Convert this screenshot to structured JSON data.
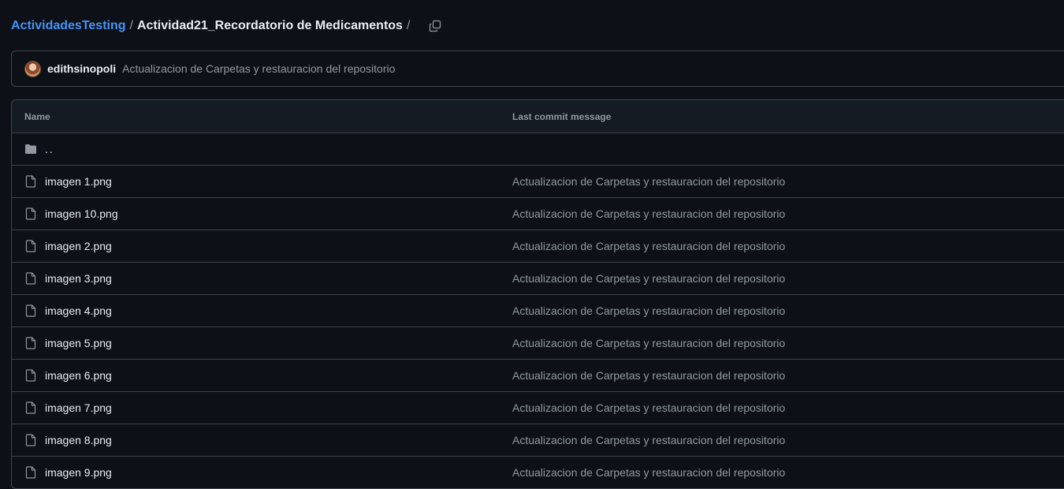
{
  "breadcrumb": {
    "repo": "ActividadesTesting",
    "separator": "/",
    "folder": "Actividad21_Recordatorio de Medicamentos",
    "trailing_separator": "/",
    "copy_icon": "copy-icon"
  },
  "commit": {
    "author": "edithsinopoli",
    "message": "Actualizacion de Carpetas y restauracion del repositorio"
  },
  "table": {
    "headers": {
      "name": "Name",
      "message": "Last commit message"
    },
    "parent_link": "..",
    "files": [
      {
        "name": "imagen 1.png",
        "message": "Actualizacion de Carpetas y restauracion del repositorio"
      },
      {
        "name": "imagen 10.png",
        "message": "Actualizacion de Carpetas y restauracion del repositorio"
      },
      {
        "name": "imagen 2.png",
        "message": "Actualizacion de Carpetas y restauracion del repositorio"
      },
      {
        "name": "imagen 3.png",
        "message": "Actualizacion de Carpetas y restauracion del repositorio"
      },
      {
        "name": "imagen 4.png",
        "message": "Actualizacion de Carpetas y restauracion del repositorio"
      },
      {
        "name": "imagen 5.png",
        "message": "Actualizacion de Carpetas y restauracion del repositorio"
      },
      {
        "name": "imagen 6.png",
        "message": "Actualizacion de Carpetas y restauracion del repositorio"
      },
      {
        "name": "imagen 7.png",
        "message": "Actualizacion de Carpetas y restauracion del repositorio"
      },
      {
        "name": "imagen 8.png",
        "message": "Actualizacion de Carpetas y restauracion del repositorio"
      },
      {
        "name": "imagen 9.png",
        "message": "Actualizacion de Carpetas y restauracion del repositorio"
      }
    ]
  },
  "colors": {
    "background": "#0d1117",
    "link": "#4493f8",
    "text": "#e6edf3",
    "muted": "#9198a1",
    "border": "#3d444d",
    "header_bg": "#151b23"
  }
}
